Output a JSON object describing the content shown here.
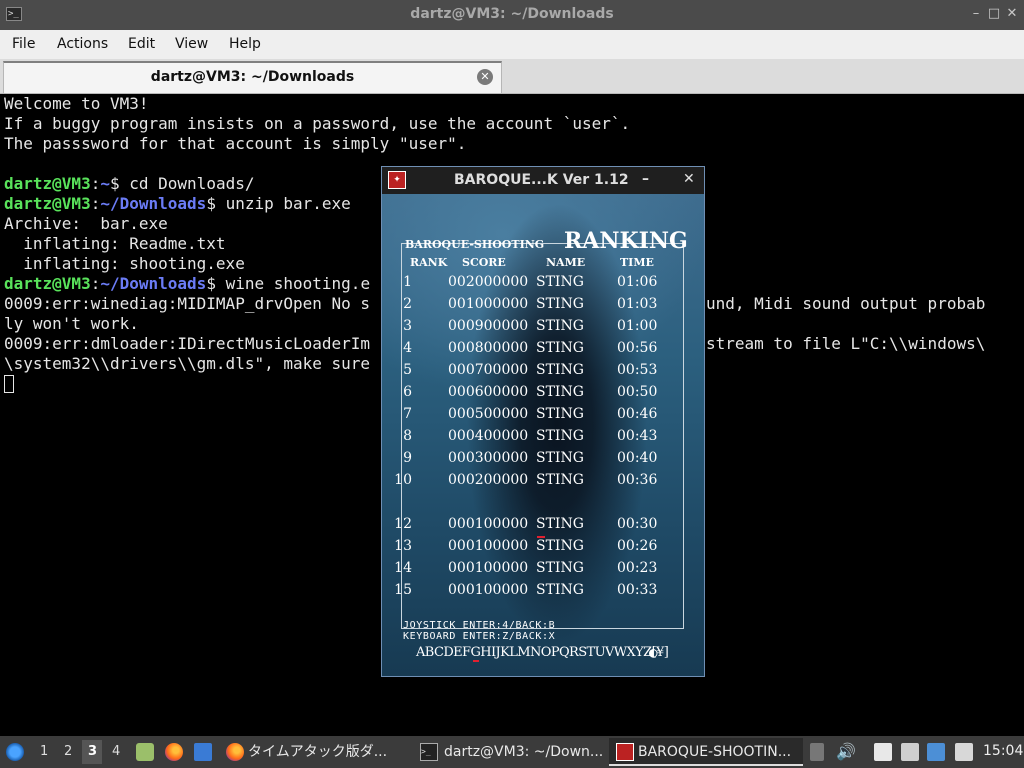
{
  "window": {
    "title": "dartz@VM3: ~/Downloads",
    "icon": "terminal-icon",
    "buttons": {
      "minimize": "–",
      "maximize": "□",
      "close": "✕"
    }
  },
  "menu": [
    "File",
    "Actions",
    "Edit",
    "View",
    "Help"
  ],
  "tab": {
    "label": "dartz@VM3: ~/Downloads",
    "close": "✕"
  },
  "terminal": {
    "lines": [
      "Welcome to VM3!",
      "If a buggy program insists on a password, use the account `user`.",
      "The passsword for that account is simply \"user\"."
    ],
    "prompt_user": "dartz@VM3",
    "prompt_sep": ":",
    "prompt_home": "~",
    "prompt_downloads": "~/Downloads",
    "prompt_end": "$ ",
    "cmd1": "cd Downloads/",
    "cmd2": "unzip bar.exe",
    "archive": "Archive:  bar.exe",
    "inflate1": "  inflating: Readme.txt",
    "inflate2": "  inflating: shooting.exe",
    "cmd3_visible": "wine shooting.e",
    "err1_left": "0009:err:winediag:MIDIMAP_drvOpen No s",
    "err1_right": "und, Midi sound output probab",
    "err1_cont": "ly won't work.",
    "err2_left": "0009:err:dmloader:IDirectMusicLoaderIm",
    "err2_right": "stream to file L\"C:\\\\windows\\",
    "err3_left": "\\system32\\\\drivers\\\\gm.dls\", make sure"
  },
  "game": {
    "title": "BAROQUE...K Ver 1.12",
    "minimize": "–",
    "close": "✕",
    "brand": "BAROQUE-SHOOTING",
    "heading": "RANKING",
    "columns": [
      "RANK",
      "SCORE",
      "NAME",
      "TIME"
    ],
    "rows": [
      {
        "rank": "1",
        "score": "002000000",
        "name": "STING",
        "time": "01:06"
      },
      {
        "rank": "2",
        "score": "001000000",
        "name": "STING",
        "time": "01:03"
      },
      {
        "rank": "3",
        "score": "000900000",
        "name": "STING",
        "time": "01:00"
      },
      {
        "rank": "4",
        "score": "000800000",
        "name": "STING",
        "time": "00:56"
      },
      {
        "rank": "5",
        "score": "000700000",
        "name": "STING",
        "time": "00:53"
      },
      {
        "rank": "6",
        "score": "000600000",
        "name": "STING",
        "time": "00:50"
      },
      {
        "rank": "7",
        "score": "000500000",
        "name": "STING",
        "time": "00:46"
      },
      {
        "rank": "8",
        "score": "000400000",
        "name": "STING",
        "time": "00:43"
      },
      {
        "rank": "9",
        "score": "000300000",
        "name": "STING",
        "time": "00:40"
      },
      {
        "rank": "10",
        "score": "000200000",
        "name": "STING",
        "time": "00:36"
      },
      {
        "rank": "",
        "score": "",
        "name": "",
        "time": ""
      },
      {
        "rank": "12",
        "score": "000100000",
        "name": "STING",
        "time": "00:30"
      },
      {
        "rank": "13",
        "score": "000100000",
        "name": "STING",
        "time": "00:26"
      },
      {
        "rank": "14",
        "score": "000100000",
        "name": "STING",
        "time": "00:23"
      },
      {
        "rank": "15",
        "score": "000100000",
        "name": "STING",
        "time": "00:33"
      }
    ],
    "joystick_help": "JOYSTICK ENTER:4/BACK:B",
    "keyboard_help": "KEYBOARD ENTER:Z/BACK:X",
    "alphabet": "ABCDEFGHIJKLMNOPQRSTUVWXYZ[¥]",
    "cursor_color": "#e02030"
  },
  "taskbar": {
    "workspaces": [
      "1",
      "2",
      "3",
      "4"
    ],
    "active_workspace": "3",
    "tasks": [
      {
        "label": "タイムアタック版ダ...",
        "icon": "firefox-icon"
      },
      {
        "label": "dartz@VM3: ~/Down...",
        "icon": "terminal-icon"
      },
      {
        "label": "BAROQUE-SHOOTIN...",
        "icon": "game-icon"
      }
    ],
    "clock": "15:04"
  }
}
